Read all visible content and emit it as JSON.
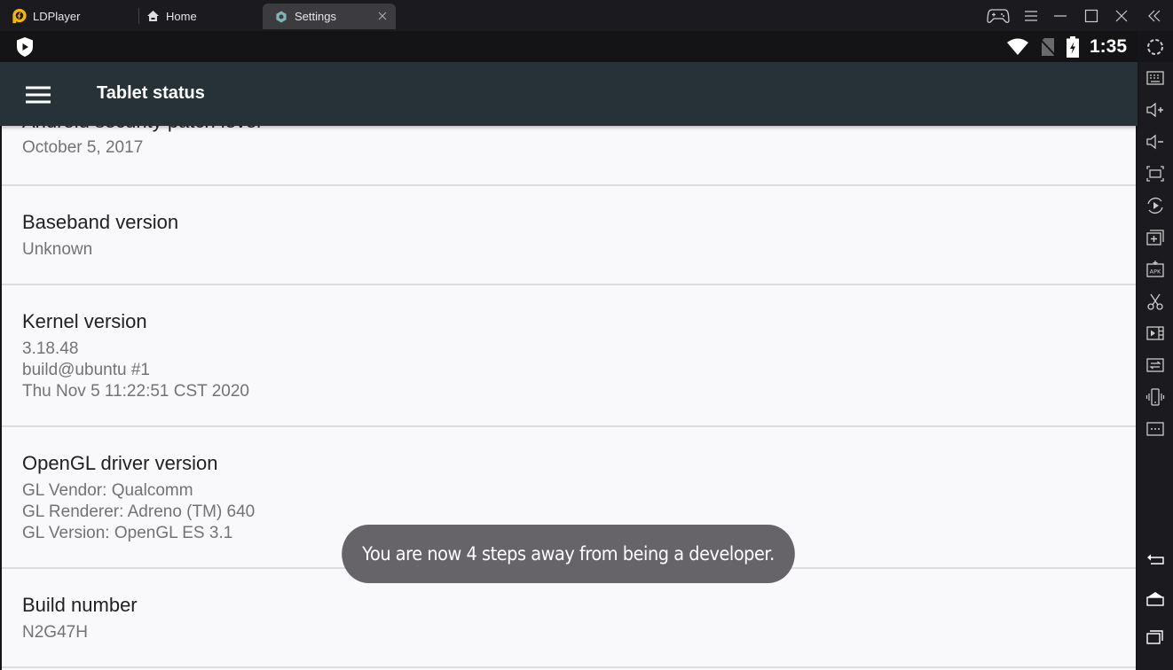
{
  "window": {
    "app_name": "LDPlayer",
    "tabs": [
      {
        "label": "Home",
        "icon": "home-icon"
      },
      {
        "label": "Settings",
        "icon": "settings-gear-icon",
        "active": true
      }
    ],
    "controls": [
      "gamepad-icon",
      "menu-icon",
      "minimize-icon",
      "maximize-icon",
      "close-icon",
      "collapse-sidebar-icon"
    ]
  },
  "statusbar": {
    "time": "1:35",
    "icons": [
      "wifi-icon",
      "no-sim-icon",
      "battery-charging-icon"
    ]
  },
  "appbar": {
    "title": "Tablet status"
  },
  "preferences": [
    {
      "title": "Android security patch level",
      "summary": "October 5, 2017"
    },
    {
      "title": "Baseband version",
      "summary": "Unknown"
    },
    {
      "title": "Kernel version",
      "summary": "3.18.48\nbuild@ubuntu #1\nThu Nov 5 11:22:51 CST 2020"
    },
    {
      "title": "OpenGL driver version",
      "summary": "GL Vendor: Qualcomm\nGL Renderer: Adreno (TM) 640\nGL Version: OpenGL ES 3.1"
    },
    {
      "title": "Build number",
      "summary": "N2G47H"
    }
  ],
  "toast": {
    "message": "You are now 4 steps away from being a developer."
  },
  "sidebar": {
    "tools": [
      "keyboard-icon",
      "volume-up-icon",
      "volume-down-icon",
      "fullscreen-icon",
      "record-icon",
      "add-window-icon",
      "install-apk-icon",
      "screenshot-scissors-icon",
      "video-icon",
      "sync-icon",
      "shake-icon",
      "more-icon"
    ],
    "nav": [
      "back-icon",
      "home-icon",
      "recents-icon"
    ]
  }
}
